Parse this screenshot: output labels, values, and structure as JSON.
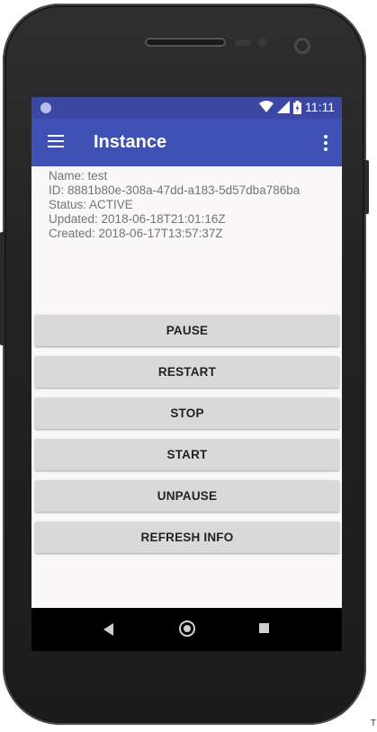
{
  "status_bar": {
    "time": "11:11",
    "icons": [
      "notification-dot-icon",
      "wifi-icon",
      "signal-icon",
      "battery-icon"
    ]
  },
  "app_bar": {
    "title": "Instance",
    "left_icon": "menu-icon",
    "right_icon": "more-vert-icon",
    "color": "#3f51b5"
  },
  "instance": {
    "name_line": "Name: test",
    "id_line": "ID: 8881b80e-308a-47dd-a183-5d57dba786ba",
    "status_line": "Status: ACTIVE",
    "updated_line": "Updated: 2018-06-18T21:01:16Z",
    "created_line": "Created: 2018-06-17T13:57:37Z"
  },
  "actions": {
    "pause": "PAUSE",
    "restart": "RESTART",
    "stop": "STOP",
    "start": "START",
    "unpause": "UNPAUSE",
    "refresh": "REFRESH INFO"
  },
  "nav_bar": {
    "icons": [
      "back-icon",
      "home-icon",
      "recents-icon"
    ]
  },
  "corner_text": "T"
}
